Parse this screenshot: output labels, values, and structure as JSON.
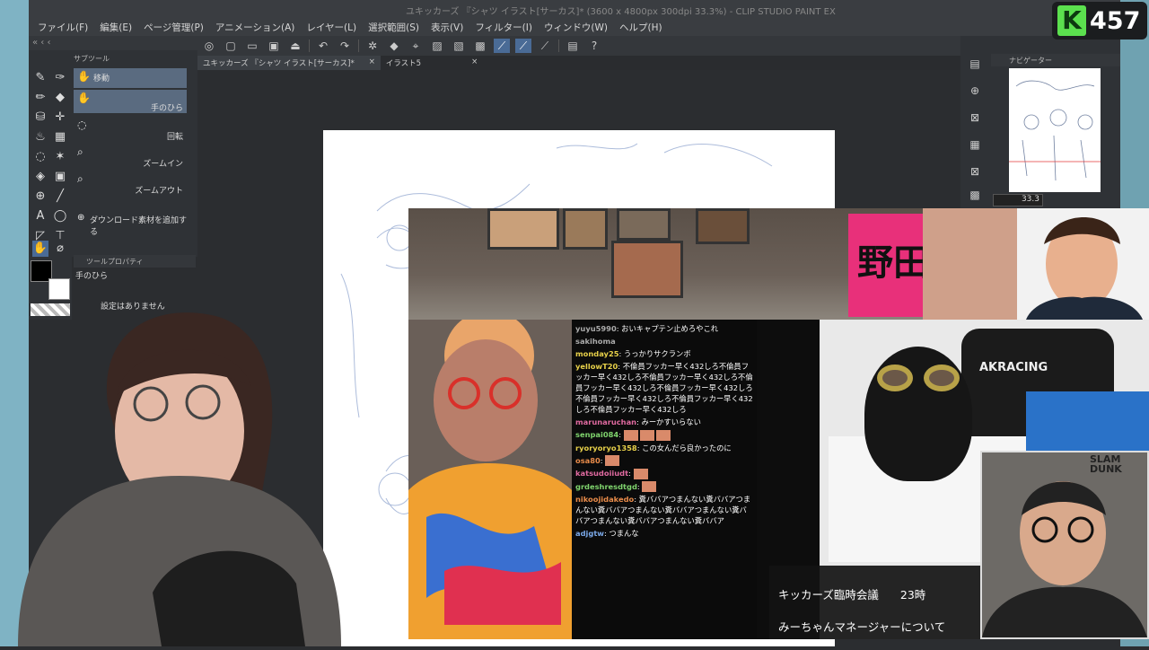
{
  "app": {
    "window_title": "ユキッカーズ 『シャツ イラスト[サーカス]* (3600 x 4800px 300dpi 33.3%) - CLIP STUDIO PAINT EX"
  },
  "menu": [
    "ファイル(F)",
    "編集(E)",
    "ページ管理(P)",
    "アニメーション(A)",
    "レイヤー(L)",
    "選択範囲(S)",
    "表示(V)",
    "フィルター(I)",
    "ウィンドウ(W)",
    "ヘルプ(H)"
  ],
  "subtool": {
    "header": "サブツール",
    "items": [
      {
        "label": "移動",
        "selected": true
      },
      {
        "label": "手のひら",
        "selected": true
      },
      {
        "label": "回転",
        "selected": false
      },
      {
        "label": "ズームイン",
        "selected": false
      },
      {
        "label": "ズームアウト",
        "selected": false
      }
    ],
    "add_material": "ダウンロード素材を追加する"
  },
  "tool_property": {
    "header": "ツールプロパティ",
    "tool_name": "手のひら",
    "empty_text": "設定はありません"
  },
  "tabs": [
    {
      "label": "ユキッカーズ 『シャツ イラスト[サーカス]*",
      "active": true
    },
    {
      "label": "イラスト5",
      "active": false
    }
  ],
  "navigator": {
    "header": "ナビゲーター",
    "zoom": "33.3"
  },
  "stream": {
    "badge_count": "457",
    "banner_text": "野田",
    "chair_brand": "AKRACING",
    "slam_text": "SLAM DUNK",
    "caption_line1": "キッカーズ臨時会議",
    "caption_time": "23時",
    "caption_line2": "みーちゃんマネージャーについて"
  },
  "chat": [
    {
      "user": "yuyu5990",
      "text": "おいキャプテン止めろやこれ",
      "color": "gr"
    },
    {
      "user": "sakihoma",
      "text": "",
      "color": "gr"
    },
    {
      "user": "monday25",
      "text": "うっかりサクランボ",
      "color": "yl"
    },
    {
      "user": "yellowT20",
      "text": "不倫員フッカー早く432しろ不倫員フッカー早く432しろ不倫員フッカー早く432しろ不倫員フッカー早く432しろ不倫員フッカー早く432しろ不倫員フッカー早く432しろ不倫員フッカー早く432しろ不倫員フッカー早く432しろ",
      "color": "yl"
    },
    {
      "user": "marunaruchan",
      "text": "みーかすいらない",
      "color": "pk"
    },
    {
      "user": "senpai084",
      "text": "",
      "color": "gn"
    },
    {
      "user": "ryoryoryo1358",
      "text": "この女んだら良かったのに",
      "color": "yl"
    },
    {
      "user": "osa80",
      "text": "",
      "color": "or"
    },
    {
      "user": "katsudoiiudt",
      "text": "",
      "color": "pk"
    },
    {
      "user": "grdeshresdtgd",
      "text": "",
      "color": "gn"
    },
    {
      "user": "nikoojidakedo",
      "text": "糞ババアつまんない糞ババアつまんない糞ババアつまんない糞ババアつまんない糞ババアつまんない糞ババアつまんない糞ババア",
      "color": "or"
    },
    {
      "user": "adjgtw",
      "text": "つまんな",
      "color": "bl"
    }
  ]
}
